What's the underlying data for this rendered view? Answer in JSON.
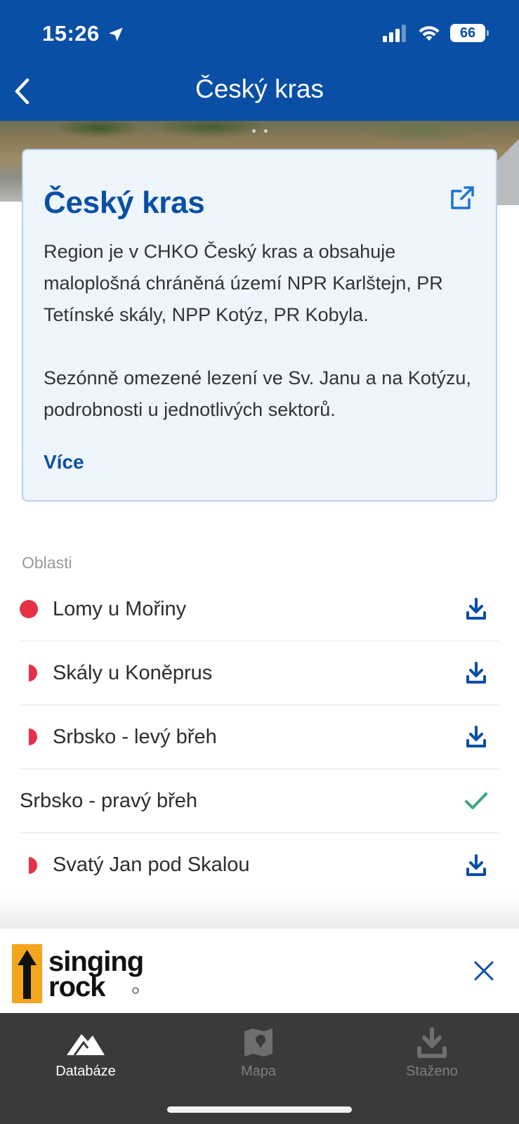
{
  "status_bar": {
    "time": "15:26",
    "battery": "66"
  },
  "nav": {
    "title": "Český kras"
  },
  "card": {
    "title": "Český kras",
    "paragraph1": "Region je v CHKO Český kras a obsahuje maloplošná chráněná území NPR Karlštejn, PR Tetínské skály, NPP Kotýz, PR Kobyla.",
    "paragraph2": "Sezónně omezené lezení ve Sv. Janu a na Kotýzu, podrobnosti u jednotlivých sektorů.",
    "more_label": "Více"
  },
  "areas": {
    "section_label": "Oblasti",
    "items": [
      {
        "label": "Lomy u Mořiny",
        "indicator": "full",
        "action": "download-icon"
      },
      {
        "label": "Skály u Koněprus",
        "indicator": "half",
        "action": "download-icon"
      },
      {
        "label": "Srbsko - levý břeh",
        "indicator": "half",
        "action": "download-icon"
      },
      {
        "label": "Srbsko - pravý břeh",
        "indicator": "none",
        "action": "check-icon"
      },
      {
        "label": "Svatý Jan pod Skalou",
        "indicator": "half",
        "action": "download-icon"
      }
    ]
  },
  "ad": {
    "brand_line1": "singing",
    "brand_line2": "rock"
  },
  "tabbar": {
    "tabs": [
      {
        "label": "Databáze",
        "icon": "mountain-icon",
        "active": true
      },
      {
        "label": "Mapa",
        "icon": "map-icon",
        "active": false
      },
      {
        "label": "Staženo",
        "icon": "download-icon",
        "active": false
      }
    ]
  },
  "colors": {
    "brand_blue": "#0a4fa6",
    "indicator_red": "#e63147",
    "check_green": "#3aa97a",
    "tabbar_bg": "#3a3a3a"
  }
}
